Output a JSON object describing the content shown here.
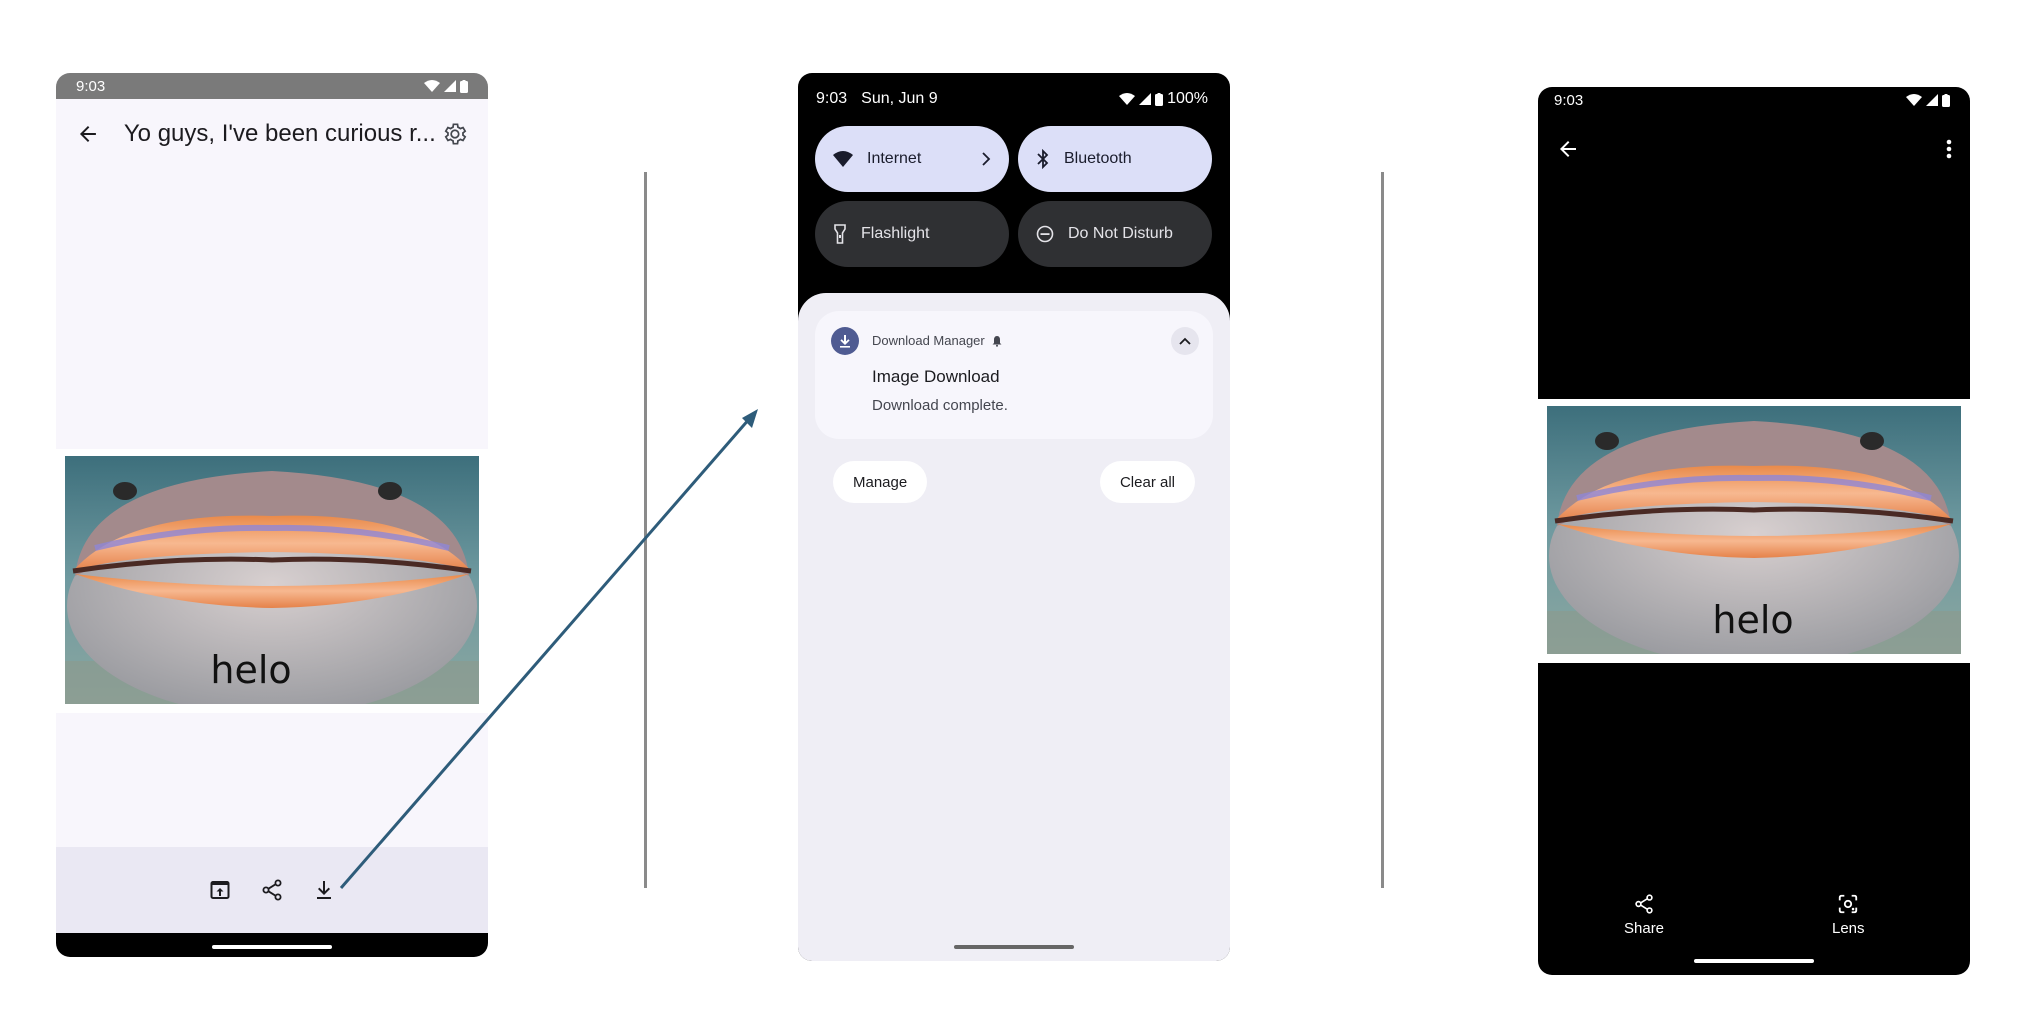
{
  "phone1": {
    "status_time": "9:03",
    "title": "Yo guys, I've been curious r...",
    "image_caption": "helo",
    "colors": {
      "statusbar": "#7a7a7a",
      "background": "#f8f6fc",
      "bottombar": "#eae8f3"
    },
    "icons": [
      "back-arrow-icon",
      "settings-gear-icon",
      "open-in-icon",
      "share-icon",
      "download-icon"
    ]
  },
  "phone2": {
    "status_time": "9:03",
    "status_date": "Sun, Jun 9",
    "battery": "100%",
    "tiles": [
      {
        "label": "Internet",
        "state": "on",
        "icon": "wifi-icon"
      },
      {
        "label": "Bluetooth",
        "state": "on",
        "icon": "bluetooth-icon"
      },
      {
        "label": "Flashlight",
        "state": "off",
        "icon": "flashlight-icon"
      },
      {
        "label": "Do Not Disturb",
        "state": "off",
        "icon": "dnd-icon"
      }
    ],
    "notification": {
      "app": "Download Manager",
      "title": "Image Download",
      "text": "Download complete."
    },
    "buttons": {
      "manage": "Manage",
      "clear_all": "Clear all"
    },
    "colors": {
      "tile_on": "#dcdff8",
      "tile_off": "#2f3033",
      "shade": "#efeef5",
      "accent": "#4f5b92"
    }
  },
  "phone3": {
    "status_time": "9:03",
    "image_caption": "helo",
    "actions": {
      "share": "Share",
      "lens": "Lens"
    },
    "icons": [
      "back-arrow-icon",
      "more-vert-icon",
      "share-icon",
      "lens-icon"
    ]
  },
  "arrow_color": "#2e5c7a"
}
